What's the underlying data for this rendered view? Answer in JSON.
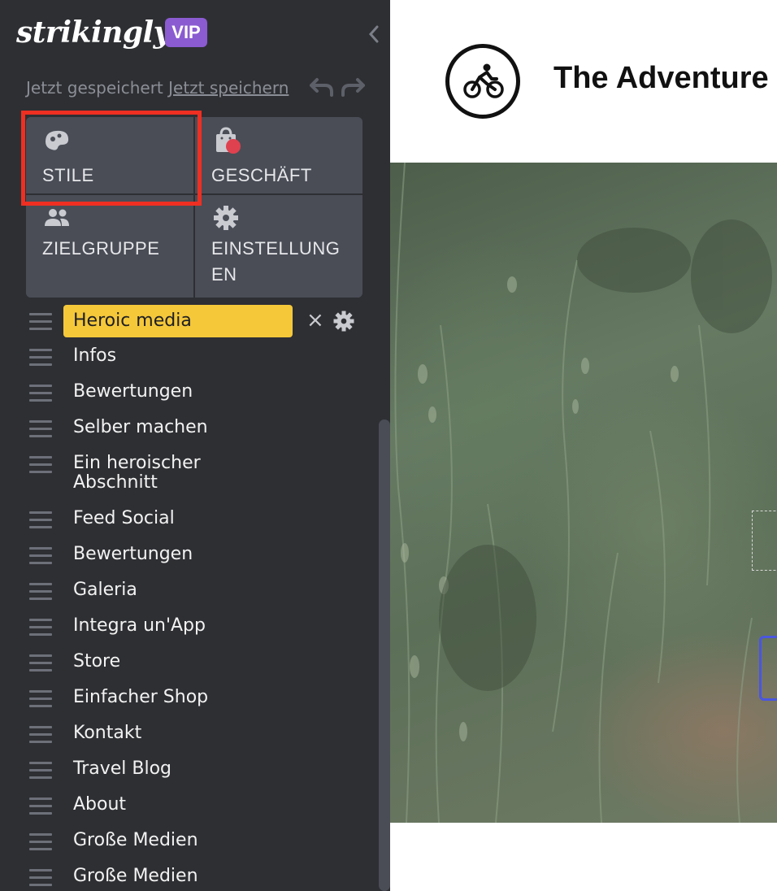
{
  "sidebar": {
    "logo_text": "strikingly",
    "badge": "VIP",
    "collapse_icon": "chevron-left-icon",
    "save_status": "Jetzt gespeichert",
    "save_link": "Jetzt speichern",
    "undo_icon": "undo-icon",
    "redo_icon": "redo-icon",
    "tiles": [
      {
        "label": "STILE",
        "icon": "palette-icon",
        "highlighted": true
      },
      {
        "label": "GESCHÄFT",
        "icon": "shopping-bag-icon",
        "notification": true
      },
      {
        "label": "ZIELGRUPPE",
        "icon": "users-icon"
      },
      {
        "label": "EINSTELLUNG\nEN",
        "icon": "gear-icon"
      }
    ],
    "accent_color": "#f5c83a",
    "highlight_color": "#ee2f22",
    "sections": [
      {
        "label": "Heroic media",
        "active": true
      },
      {
        "label": "Infos"
      },
      {
        "label": "Bewertungen"
      },
      {
        "label": "Selber machen"
      },
      {
        "label": "Ein heroischer\nAbschnitt"
      },
      {
        "label": "Feed Social"
      },
      {
        "label": "Bewertungen"
      },
      {
        "label": "Galeria"
      },
      {
        "label": "Integra un'App"
      },
      {
        "label": "Store"
      },
      {
        "label": "Einfacher Shop"
      },
      {
        "label": "Kontakt"
      },
      {
        "label": "Travel Blog"
      },
      {
        "label": "About"
      },
      {
        "label": "Große Medien"
      },
      {
        "label": "Große Medien"
      }
    ],
    "section_actions": {
      "remove": "×",
      "settings_icon": "gear-icon"
    }
  },
  "preview": {
    "site_title": "The Adventure",
    "site_logo_icon": "cyclist-icon"
  }
}
